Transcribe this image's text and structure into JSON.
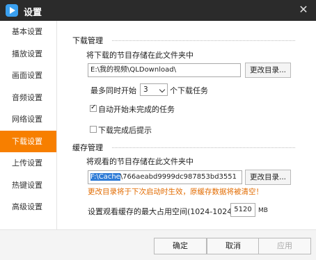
{
  "window": {
    "title": "设置"
  },
  "sidebar": {
    "items": [
      {
        "label": "基本设置"
      },
      {
        "label": "播放设置"
      },
      {
        "label": "画面设置"
      },
      {
        "label": "音频设置"
      },
      {
        "label": "网络设置"
      },
      {
        "label": "下载设置",
        "active": true
      },
      {
        "label": "上传设置"
      },
      {
        "label": "热键设置"
      },
      {
        "label": "高级设置"
      }
    ]
  },
  "download": {
    "section_title": "下载管理",
    "folder_label": "将下载的节目存储在此文件夹中",
    "folder_value": "E:\\我的视频\\QLDownload\\",
    "change_dir_button": "更改目录...",
    "max_prefix": "最多同时开始",
    "max_value": "3",
    "max_suffix": "个下载任务",
    "auto_start_label": "自动开始未完成的任务",
    "auto_start_checked": true,
    "notify_label": "下载完成后提示",
    "notify_checked": false
  },
  "cache": {
    "section_title": "缓存管理",
    "folder_label": "将观看的节目存储在此文件夹中",
    "folder_value_selected": "F:\\Cache",
    "folder_value_rest": "\\766aeabd9999dc987853bd3551",
    "change_dir_button": "更改目录...",
    "warning": "更改目录将于下次启动时生效，原缓存数据将被清空！",
    "max_size_label": "设置观看缓存的最大占用空间(1024-10240)",
    "max_size_value": "5120",
    "max_size_unit": "MB"
  },
  "footer": {
    "ok_button": "确定",
    "cancel_button": "取消",
    "apply_button": "应用"
  },
  "colors": {
    "accent": "#f77f00",
    "titlebar": "#2b2b2b",
    "warning": "#e26b00",
    "selection": "#2e7bd6"
  }
}
